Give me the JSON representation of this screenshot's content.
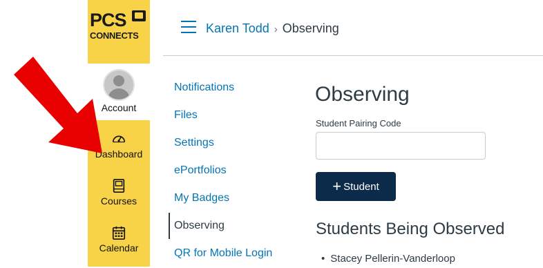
{
  "brand": {
    "logo_top": "PCS",
    "logo_bottom": "CONNECTS"
  },
  "global_nav": {
    "account_label": "Account",
    "items": [
      {
        "label": "Dashboard",
        "icon": "dashboard-icon"
      },
      {
        "label": "Courses",
        "icon": "courses-icon"
      },
      {
        "label": "Calendar",
        "icon": "calendar-icon"
      }
    ]
  },
  "breadcrumb": {
    "parent": "Karen Todd",
    "separator": "›",
    "current": "Observing"
  },
  "sub_nav": {
    "items": [
      {
        "label": "Notifications",
        "active": false
      },
      {
        "label": "Files",
        "active": false
      },
      {
        "label": "Settings",
        "active": false
      },
      {
        "label": "ePortfolios",
        "active": false
      },
      {
        "label": "My Badges",
        "active": false
      },
      {
        "label": "Observing",
        "active": true
      },
      {
        "label": "QR for Mobile Login",
        "active": false
      }
    ]
  },
  "main": {
    "title": "Observing",
    "pairing_label": "Student Pairing Code",
    "pairing_value": "",
    "add_button_icon": "+",
    "add_button_label": "Student",
    "observed_title": "Students Being Observed",
    "observed_students": [
      "Stacey Pellerin-Vanderloop"
    ]
  },
  "colors": {
    "nav_bg": "#f8d347",
    "link": "#0374b5",
    "button_bg": "#0c2b4a",
    "arrow": "#e80000"
  }
}
